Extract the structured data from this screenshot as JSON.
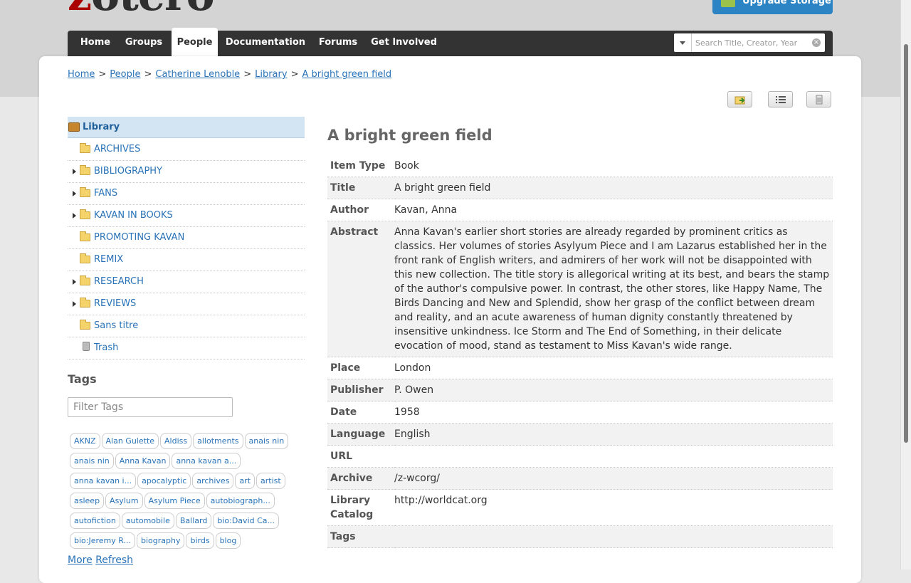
{
  "header": {
    "logo_z": "z",
    "logo_rest": "otero",
    "upgrade_label": "Upgrade Storage"
  },
  "nav": {
    "items": [
      "Home",
      "Groups",
      "People",
      "Documentation",
      "Forums",
      "Get Involved"
    ],
    "active": "People",
    "search_placeholder": "Search Title, Creator, Year"
  },
  "breadcrumb": [
    "Home",
    "People",
    "Catherine Lenoble",
    "Library",
    "A bright green field"
  ],
  "breadcrumb_sep": ">",
  "toolbar": {
    "icons": [
      "export-icon",
      "list-view-icon",
      "cite-icon"
    ]
  },
  "library": {
    "label": "Library",
    "collections": [
      {
        "label": "ARCHIVES",
        "expandable": false
      },
      {
        "label": "BIBLIOGRAPHY",
        "expandable": true
      },
      {
        "label": "FANS",
        "expandable": true
      },
      {
        "label": "KAVAN IN BOOKS",
        "expandable": true
      },
      {
        "label": "PROMOTING KAVAN",
        "expandable": false
      },
      {
        "label": "REMIX",
        "expandable": false
      },
      {
        "label": "RESEARCH",
        "expandable": true
      },
      {
        "label": "REVIEWS",
        "expandable": true
      },
      {
        "label": "Sans titre",
        "expandable": false
      },
      {
        "label": "Trash",
        "expandable": false,
        "trash": true
      }
    ]
  },
  "tags": {
    "heading": "Tags",
    "filter_placeholder": "Filter Tags",
    "rows": [
      [
        "AKNZ",
        "Alan Gulette",
        "Aldiss",
        "allotments",
        "anais nin"
      ],
      [
        "anais nin",
        "Anna Kavan",
        "anna kavan a..."
      ],
      [
        "anna kavan i...",
        "apocalyptic",
        "archives",
        "art",
        "artist"
      ],
      [
        "asleep",
        "Asylum",
        "Asylum Piece",
        "autobiograph..."
      ],
      [
        "autofiction",
        "automobile",
        "Ballard",
        "bio:David Ca..."
      ],
      [
        "bio:Jeremy R...",
        "biography",
        "birds",
        "blog"
      ]
    ],
    "more_label": "More",
    "refresh_label": "Refresh"
  },
  "item": {
    "title": "A bright green field",
    "fields": [
      {
        "label": "Item Type",
        "value": "Book"
      },
      {
        "label": "Title",
        "value": "A bright green field"
      },
      {
        "label": "Author",
        "value": "Kavan, Anna"
      },
      {
        "label": "Abstract",
        "value": "Anna Kavan's earlier short stories are already regarded by prominent critics as classics. Her volumes of stories Asylyum Piece and I am Lazarus established her in the front rank of English writers, and admirers of her work will not be disappointed with this new collection. The title story is allegorical writing at its best, and bears the stamp of the author's compulsive power. In contrast, the other stores, like Happy Name, The Birds Dancing and New and Splendid, show her grasp of the conflict between dream and reality, and an acute awareness of human dignity constantly threatened by insensitive unkindness. Ice Storm and The End of Something, in their delicate evocation of mood, stand as testament to Miss Kavan's wide range."
      },
      {
        "label": "Place",
        "value": "London"
      },
      {
        "label": "Publisher",
        "value": "P. Owen"
      },
      {
        "label": "Date",
        "value": "1958"
      },
      {
        "label": "Language",
        "value": "English"
      },
      {
        "label": "URL",
        "value": ""
      },
      {
        "label": "Archive",
        "value": "/z-wcorg/"
      },
      {
        "label": "Library Catalog",
        "value": "http://worldcat.org"
      },
      {
        "label": "Tags",
        "value": ""
      }
    ]
  },
  "colors": {
    "link": "#2a73b8",
    "nav_bg": "#333333",
    "upgrade_bg": "#2d84c4",
    "library_highlight": "#d3e4f2"
  }
}
